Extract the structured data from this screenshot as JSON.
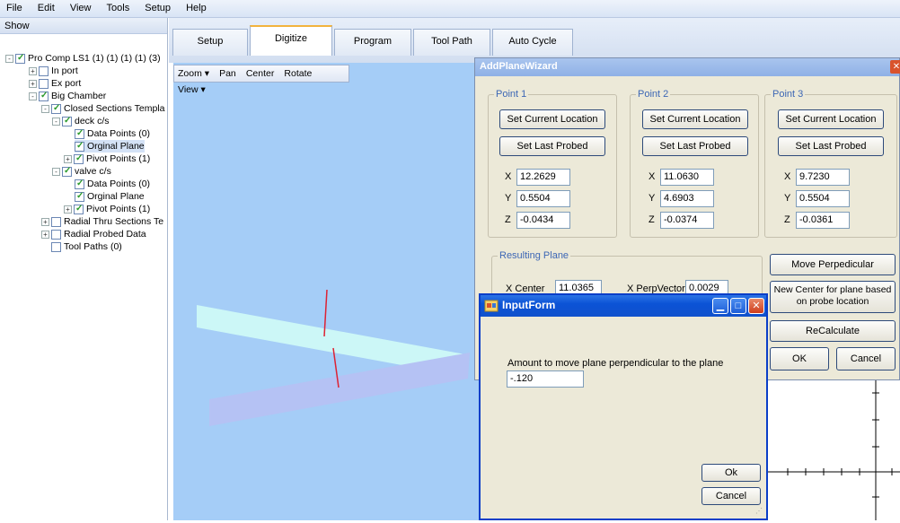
{
  "menu": [
    "File",
    "Edit",
    "View",
    "Tools",
    "Setup",
    "Help"
  ],
  "left": {
    "show": "Show",
    "tree": [
      {
        "label": "Pro Comp LS1 (1) (1) (1) (1) (3)",
        "checked": true,
        "exp": "-"
      },
      {
        "label": "In port",
        "checked": false,
        "exp": "+"
      },
      {
        "label": "Ex port",
        "checked": false,
        "exp": "+"
      },
      {
        "label": "Big Chamber",
        "checked": true,
        "exp": "-"
      },
      {
        "label": "Closed Sections Templa",
        "checked": true,
        "exp": "-"
      },
      {
        "label": "deck c/s",
        "checked": true,
        "exp": "-"
      },
      {
        "label": "Data Points (0)",
        "checked": true,
        "exp": ""
      },
      {
        "label": "Orginal Plane",
        "checked": true,
        "exp": ""
      },
      {
        "label": "Pivot Points (1)",
        "checked": true,
        "exp": "+"
      },
      {
        "label": "valve c/s",
        "checked": true,
        "exp": "-"
      },
      {
        "label": "Data Points (0)",
        "checked": true,
        "exp": ""
      },
      {
        "label": "Orginal Plane",
        "checked": true,
        "exp": ""
      },
      {
        "label": "Pivot Points (1)",
        "checked": true,
        "exp": "+"
      },
      {
        "label": "Radial Thru Sections Te",
        "checked": false,
        "exp": "+"
      },
      {
        "label": "Radial Probed Data",
        "checked": false,
        "exp": "+"
      },
      {
        "label": "Tool Paths (0)",
        "checked": false,
        "exp": ""
      }
    ]
  },
  "tabs": [
    "Setup",
    "Digitize",
    "Program",
    "Tool Path",
    "Auto Cycle"
  ],
  "view_toolbar": [
    "Zoom ▾",
    "Pan",
    "Center",
    "Rotate",
    "View ▾"
  ],
  "wizard": {
    "title": "AddPlaneWizard",
    "points": [
      {
        "name": "Point 1",
        "x": "12.2629",
        "y": "0.5504",
        "z": "-0.0434"
      },
      {
        "name": "Point 2",
        "x": "11.0630",
        "y": "4.6903",
        "z": "-0.0374"
      },
      {
        "name": "Point 3",
        "x": "9.7230",
        "y": "0.5504",
        "z": "-0.0361"
      }
    ],
    "set_current": "Set Current Location",
    "set_last": "Set Last Probed",
    "axis_x": "X",
    "axis_y": "Y",
    "axis_z": "Z",
    "resulting": "Resulting Plane",
    "xcenter_label": "X Center",
    "xcenter": "11.0365",
    "xperp_label": "X PerpVector",
    "xperp": "0.0029",
    "move_perp": "Move Perpedicular",
    "new_center": "New Center for plane based on probe location",
    "recalc": "ReCalculate",
    "ok": "OK",
    "cancel": "Cancel"
  },
  "input_form": {
    "title": "InputForm",
    "prompt": "Amount to move plane perpendicular to the plane",
    "value": "-.120",
    "ok": "Ok",
    "cancel": "Cancel"
  }
}
